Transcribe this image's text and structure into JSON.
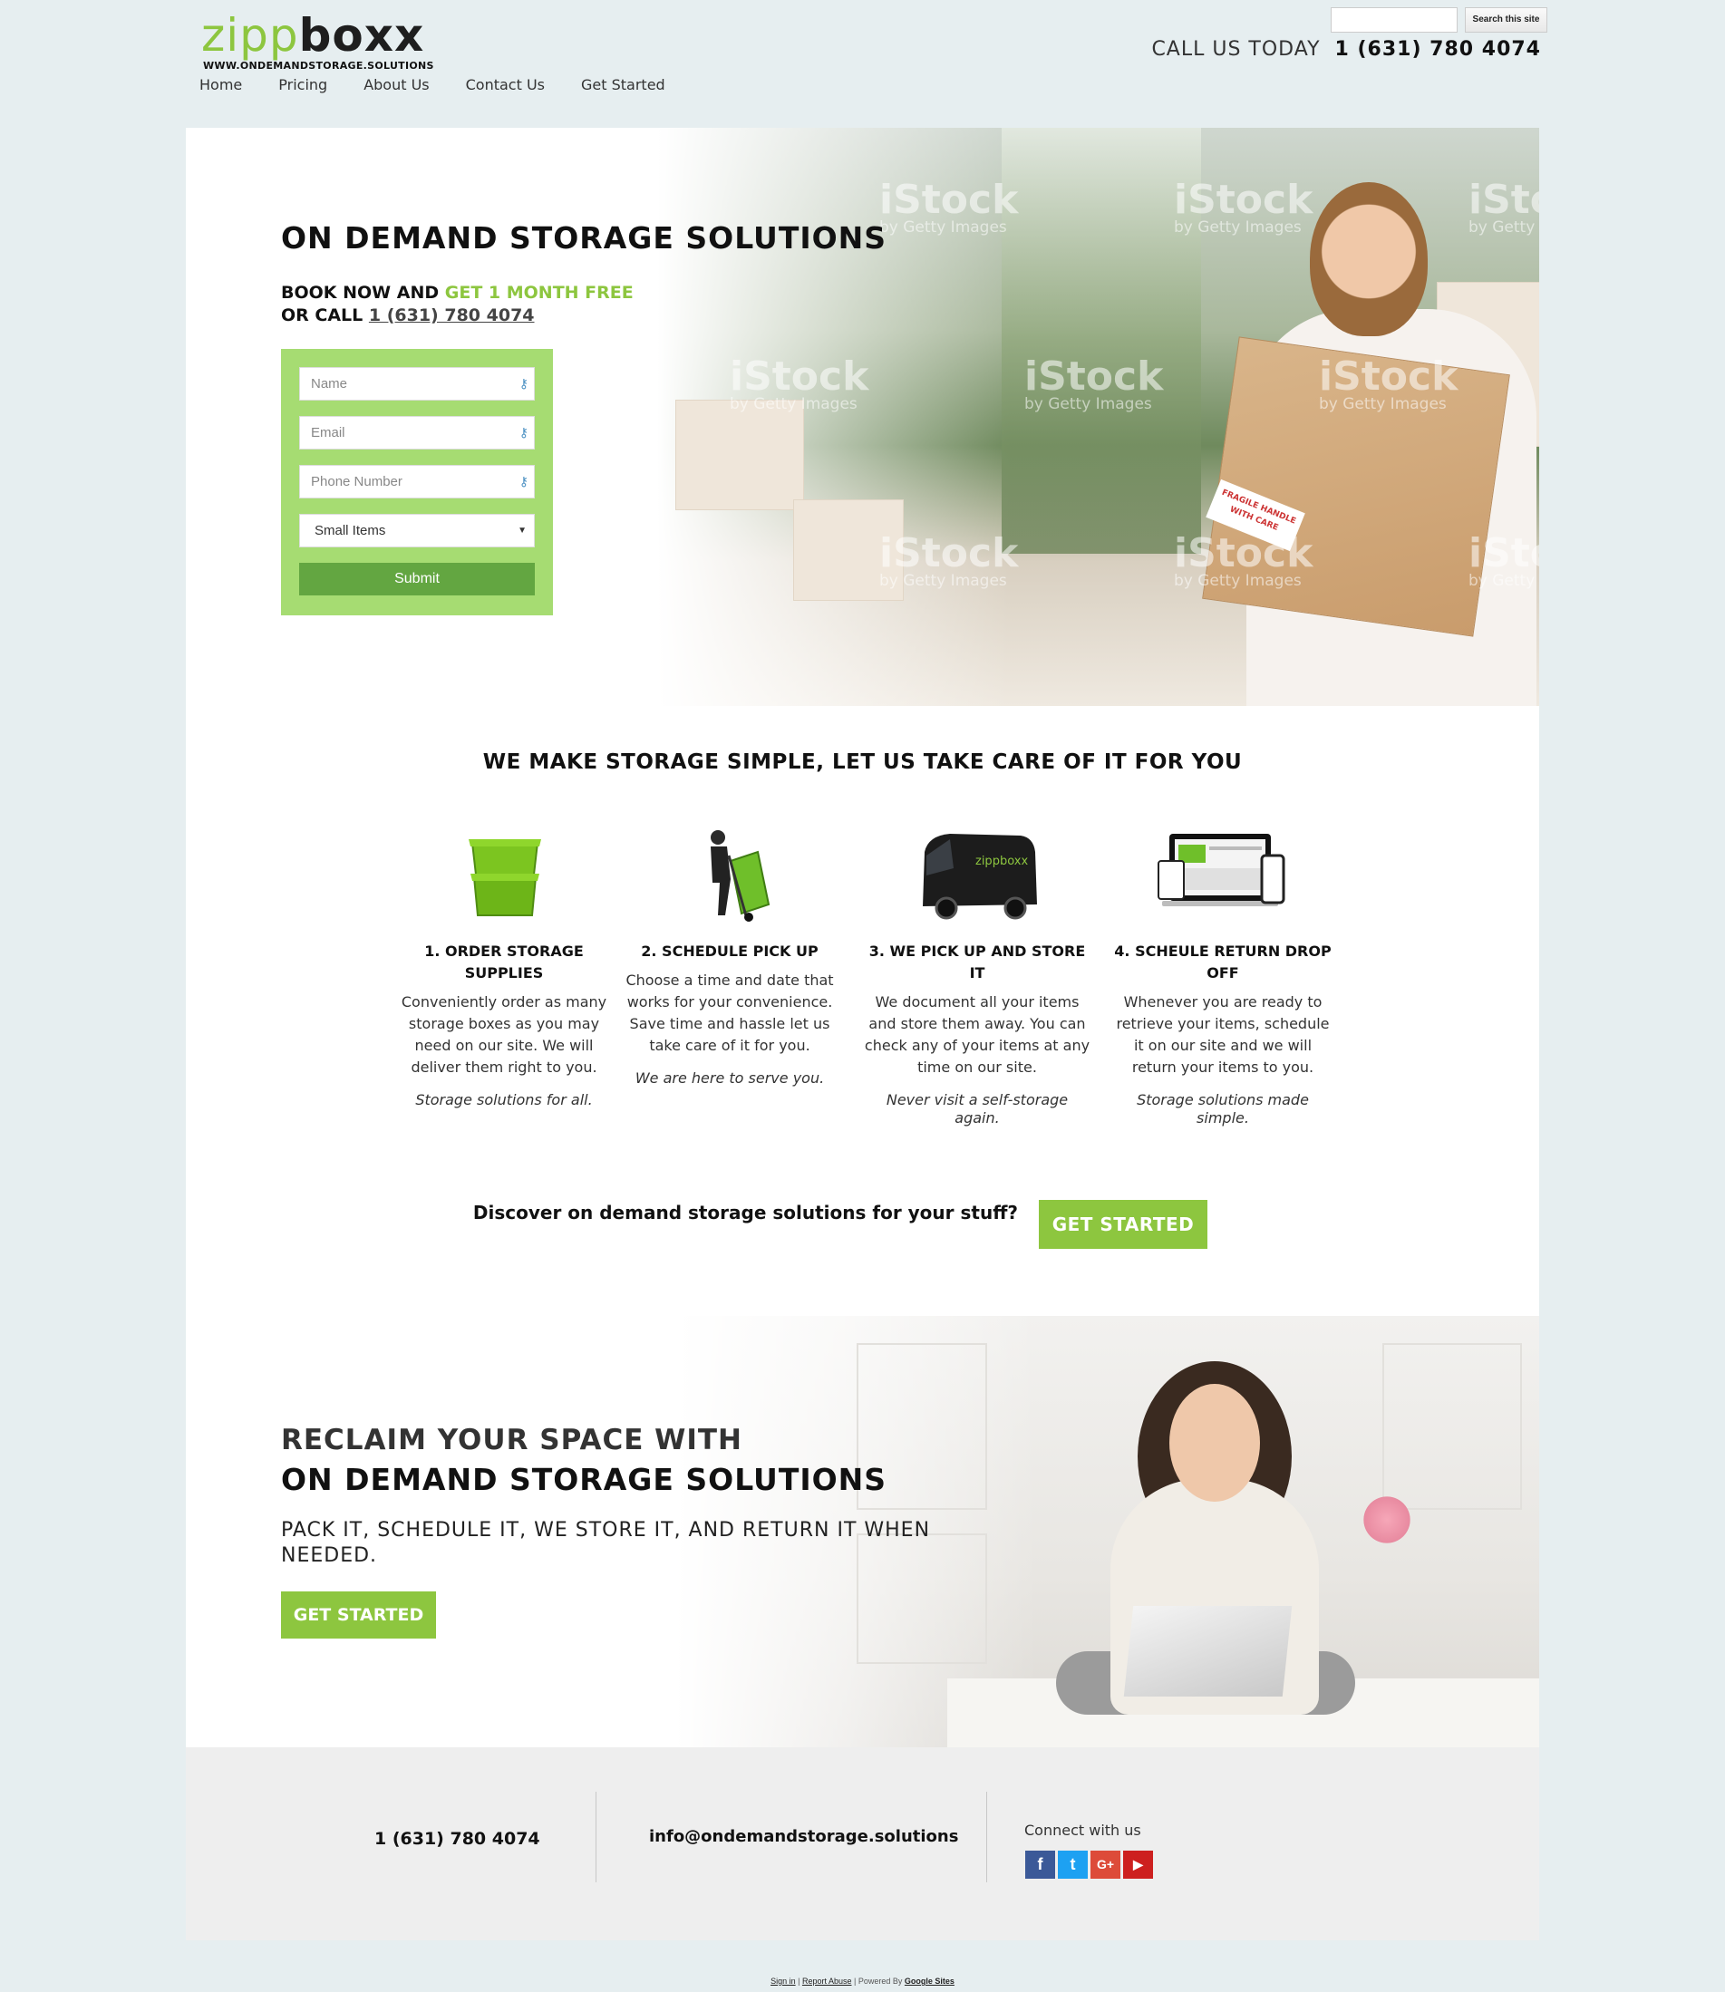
{
  "header": {
    "logo_zipp": "zipp",
    "logo_boxx": "boxx",
    "logo_sub": "WWW.ONDEMANDSTORAGE.SOLUTIONS",
    "search_button": "Search this site",
    "call_label": "CALL US TODAY",
    "call_number": "1 (631) 780 4074"
  },
  "nav": [
    "Home",
    "Pricing",
    "About Us",
    "Contact Us",
    "Get Started"
  ],
  "hero1": {
    "title": "ON DEMAND STORAGE SOLUTIONS",
    "book_prefix": "BOOK NOW AND ",
    "book_highlight": "GET 1 MONTH FREE",
    "call_prefix": "OR CALL ",
    "call_number": "1 (631) 780 4074",
    "watermark_brand": "iStock",
    "watermark_sub": "by Getty Images",
    "box_label": "FRAGILE HANDLE WITH CARE",
    "form": {
      "name_placeholder": "Name",
      "email_placeholder": "Email",
      "phone_placeholder": "Phone Number",
      "select_value": "Small Items",
      "submit": "Submit"
    }
  },
  "steps_section": {
    "title": "WE MAKE STORAGE SIMPLE, LET US TAKE CARE OF IT FOR YOU",
    "steps": [
      {
        "head": "1. ORDER STORAGE SUPPLIES",
        "body": "Conveniently order as many storage boxes as you may need on our site. We will deliver them right to you.",
        "tag": "Storage solutions for all."
      },
      {
        "head": "2. SCHEDULE PICK UP",
        "body": "Choose a time and date that works for your convenience. Save time and hassle let us take care of it for you.",
        "tag": "We are here to serve you."
      },
      {
        "head": "3. WE PICK UP AND STORE IT",
        "body": "We document all your items and store them away. You can check any of your items at any time on our site.",
        "tag": "Never visit a self-storage again."
      },
      {
        "head": "4. SCHEULE RETURN DROP OFF",
        "body": "Whenever you are ready to retrieve your items, schedule it on our site and we will return your items to you.",
        "tag": "Storage solutions made simple."
      }
    ],
    "van_logo": "zippboxx"
  },
  "cta": {
    "text": "Discover on demand storage solutions for your stuff?",
    "button": "GET STARTED"
  },
  "hero2": {
    "title1": "RECLAIM YOUR SPACE WITH",
    "title2": "ON DEMAND STORAGE SOLUTIONS",
    "subtitle": "PACK IT, SCHEDULE IT, WE STORE IT, AND RETURN IT WHEN NEEDED.",
    "button": "GET STARTED"
  },
  "footer": {
    "phone": "1 (631) 780 4074",
    "email": "info@ondemandstorage.solutions",
    "connect": "Connect with us",
    "social_glyphs": [
      "f",
      "t",
      "G+",
      "▶"
    ]
  },
  "bottom": {
    "sign_in": "Sign in",
    "report_abuse": "Report Abuse",
    "powered_by": "Powered By",
    "google_sites": "Google Sites"
  },
  "colors": {
    "accent_green": "#8dc63f",
    "form_green": "#a6dc72",
    "submit_green": "#63a641",
    "page_bg": "#e6eef0",
    "facebook": "#3b5998",
    "twitter": "#1da1f2",
    "google_plus": "#dd4b39",
    "youtube": "#cd201f"
  }
}
